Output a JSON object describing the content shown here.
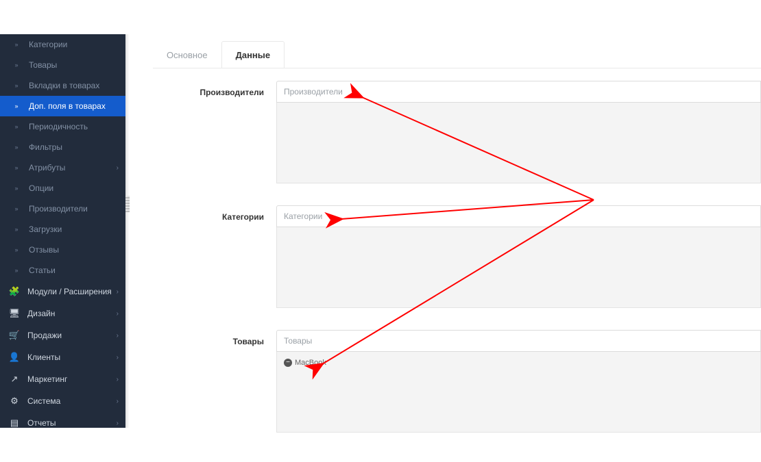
{
  "sidebar": {
    "catalog_children": [
      {
        "label": "Категории",
        "active": false,
        "has_children": false
      },
      {
        "label": "Товары",
        "active": false,
        "has_children": false
      },
      {
        "label": "Вкладки в товарах",
        "active": false,
        "has_children": false
      },
      {
        "label": "Доп. поля в товарах",
        "active": true,
        "has_children": false
      },
      {
        "label": "Периодичность",
        "active": false,
        "has_children": false
      },
      {
        "label": "Фильтры",
        "active": false,
        "has_children": false
      },
      {
        "label": "Атрибуты",
        "active": false,
        "has_children": true
      },
      {
        "label": "Опции",
        "active": false,
        "has_children": false
      },
      {
        "label": "Производители",
        "active": false,
        "has_children": false
      },
      {
        "label": "Загрузки",
        "active": false,
        "has_children": false
      },
      {
        "label": "Отзывы",
        "active": false,
        "has_children": false
      },
      {
        "label": "Статьи",
        "active": false,
        "has_children": false
      }
    ],
    "main_items": [
      {
        "icon": "puzzle",
        "label": "Модули / Расширения"
      },
      {
        "icon": "display",
        "label": "Дизайн"
      },
      {
        "icon": "cart",
        "label": "Продажи"
      },
      {
        "icon": "user",
        "label": "Клиенты"
      },
      {
        "icon": "share",
        "label": "Маркетинг"
      },
      {
        "icon": "cog",
        "label": "Система"
      },
      {
        "icon": "barchart",
        "label": "Отчеты"
      }
    ]
  },
  "tabs": {
    "main": "Основное",
    "data": "Данные",
    "active": "data"
  },
  "fields": {
    "manufacturers": {
      "label": "Производители",
      "placeholder": "Производители",
      "tags": []
    },
    "categories": {
      "label": "Категории",
      "placeholder": "Категории",
      "tags": []
    },
    "products": {
      "label": "Товары",
      "placeholder": "Товары",
      "tags": [
        "MacBook"
      ]
    }
  },
  "icons": {
    "arrow_sub": "»",
    "chevron_right": "›",
    "puzzle": "🧩",
    "display": "🖥",
    "cart": "🛒",
    "user": "👤",
    "share": "↗",
    "cog": "⚙",
    "barchart": "▤",
    "minus": "−"
  },
  "annotation_color": "#ff0000"
}
